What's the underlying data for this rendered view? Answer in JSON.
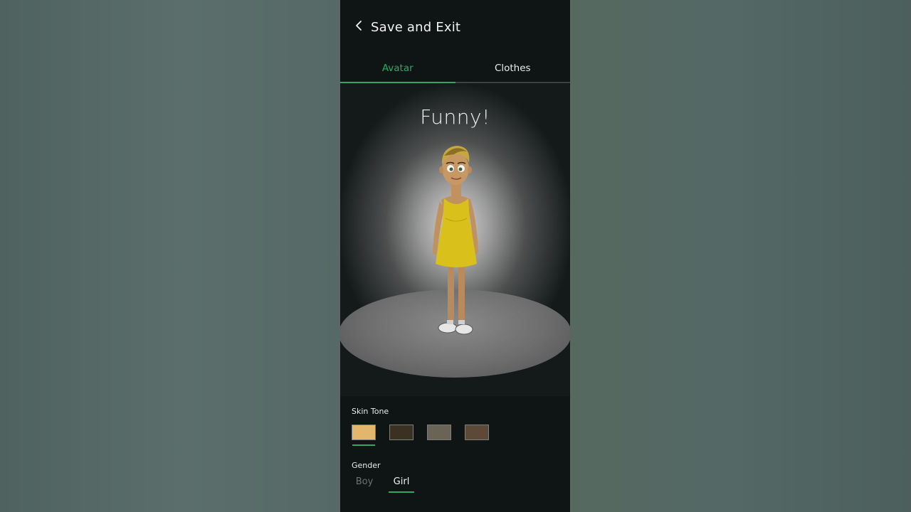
{
  "header": {
    "back_label": "Save and Exit"
  },
  "tabs": [
    {
      "label": "Avatar",
      "active": true
    },
    {
      "label": "Clothes",
      "active": false
    }
  ],
  "stage": {
    "title": "Funny!"
  },
  "skin_tone": {
    "label": "Skin Tone",
    "swatches": [
      "#e2b66d",
      "#3b3121",
      "#696456",
      "#5d4938"
    ],
    "selected_index": 0
  },
  "gender": {
    "label": "Gender",
    "options": [
      "Boy",
      "Girl"
    ],
    "selected": "Girl"
  },
  "colors": {
    "accent": "#2fa866",
    "panel_background": "#0f1515",
    "dress": "#d9c01a"
  }
}
